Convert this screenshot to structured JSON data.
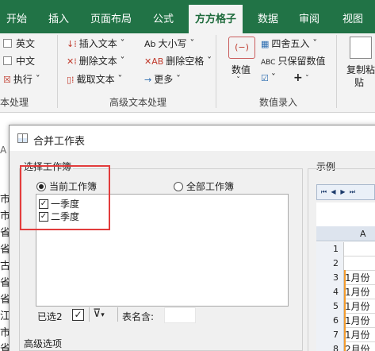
{
  "ribbon_tabs": [
    "开始",
    "插入",
    "页面布局",
    "公式",
    "方方格子",
    "数据",
    "审阅",
    "视图"
  ],
  "active_tab": "方方格子",
  "ribbon": {
    "left_group": {
      "english": "英文",
      "chinese": "中文",
      "execute": "执行",
      "label": "本处理"
    },
    "advanced_text": {
      "insert_text": "插入文本",
      "delete_text": "删除文本",
      "extract_text": "截取文本",
      "case": "大小写",
      "delete_spaces": "删除空格",
      "more": "更多",
      "label": "高级文本处理"
    },
    "numeric_entry": {
      "numeric": "数值",
      "round": "四舍五入",
      "keep_numeric": "只保留数值",
      "label": "数值录入"
    },
    "copy_paste": {
      "line1": "复制粘",
      "line2": "贴"
    }
  },
  "sheet_left_chars": [
    "市",
    "市",
    "省",
    "省",
    "古",
    "省",
    "省",
    "江",
    "市",
    "省"
  ],
  "dialog": {
    "title": "合并工作表",
    "select_group_label": "选择工作簿",
    "radio_current": "当前工作簿",
    "radio_all": "全部工作簿",
    "sheets": [
      {
        "label": "一季度",
        "checked": true
      },
      {
        "label": "二季度",
        "checked": true
      }
    ],
    "selected_count": "已选2",
    "table_name_label": "表名含:",
    "table_name_value": "",
    "advanced_label": "高级选项",
    "preview_label": "示例"
  },
  "preview": {
    "column": "A",
    "rows": [
      {
        "n": "1",
        "v": ""
      },
      {
        "n": "2",
        "v": ""
      },
      {
        "n": "3",
        "v": "1月份"
      },
      {
        "n": "4",
        "v": "1月份"
      },
      {
        "n": "5",
        "v": "1月份"
      },
      {
        "n": "6",
        "v": "1月份"
      },
      {
        "n": "7",
        "v": "1月份"
      },
      {
        "n": "8",
        "v": "2月份"
      }
    ]
  },
  "colors": {
    "ribbon_green": "#217346",
    "highlight_red": "#e23c3c",
    "preview_orange": "#f39b2c"
  }
}
